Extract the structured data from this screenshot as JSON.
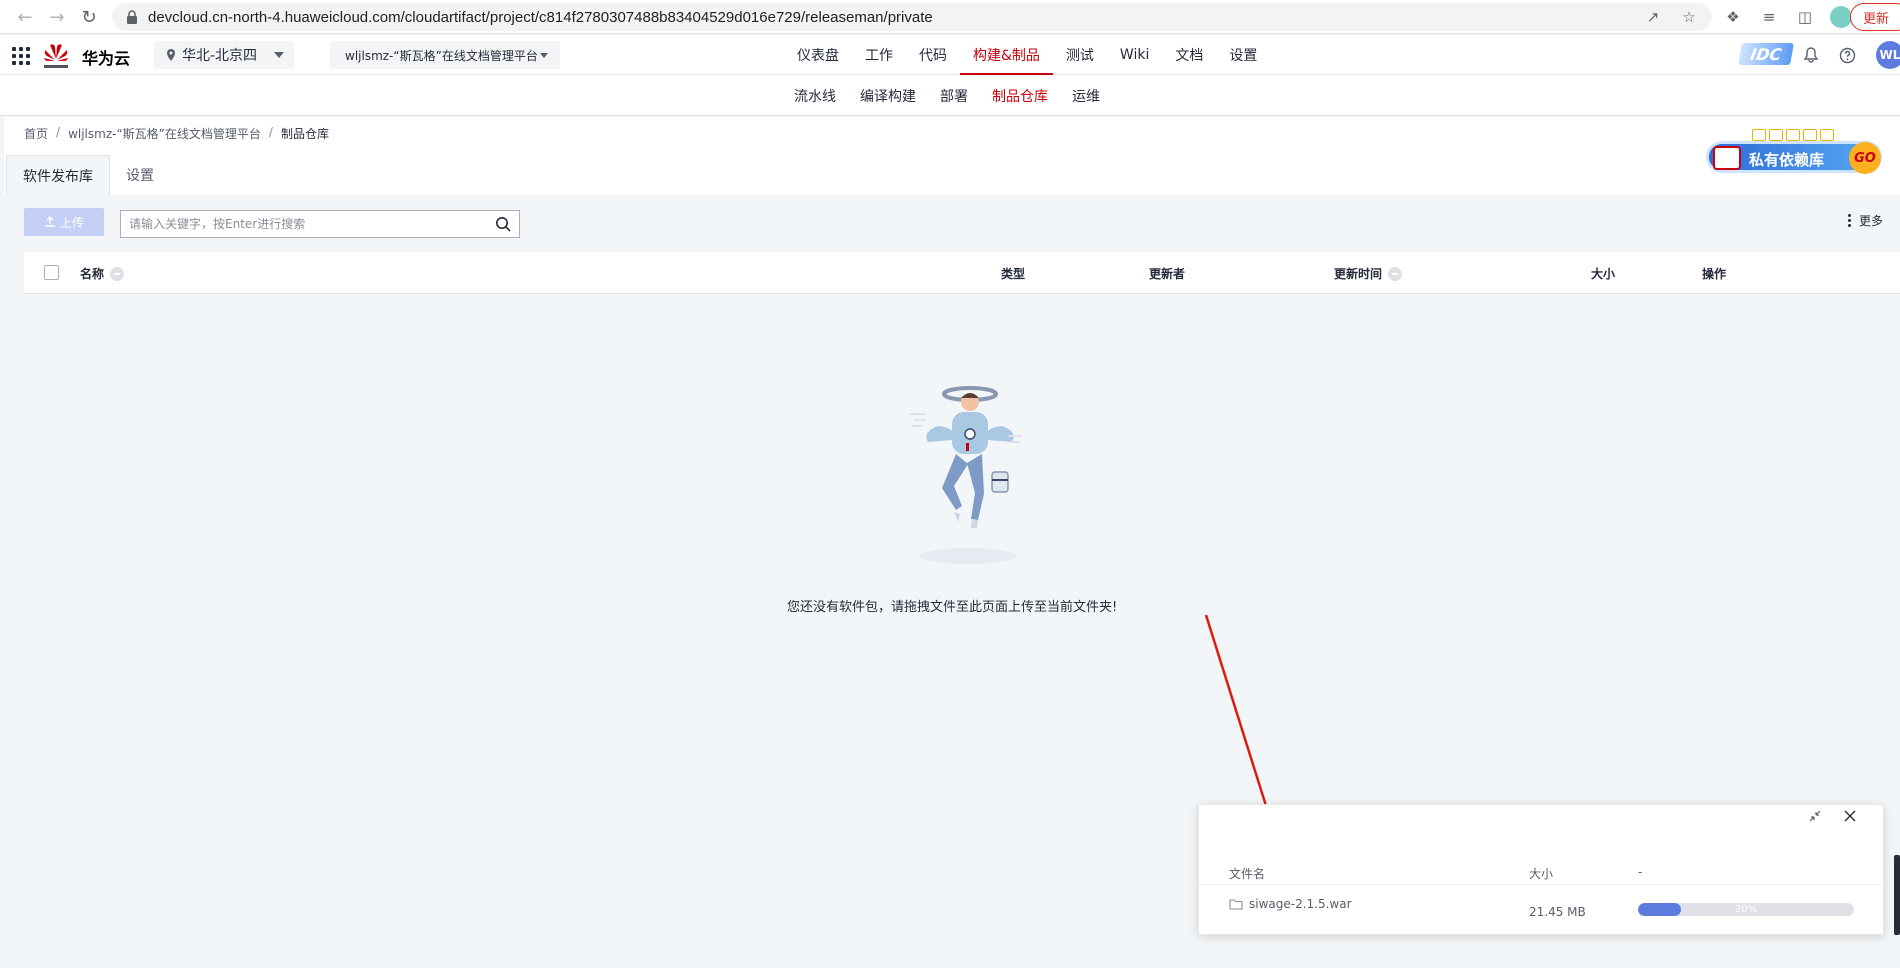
{
  "browser": {
    "url": "devcloud.cn-north-4.huaweicloud.com/cloudartifact/project/c814f2780307488b83404529d016e729/releaseman/private",
    "update_label": "更新"
  },
  "header": {
    "brand": "华为云",
    "region": "华北-北京四",
    "project": "wljlsmz-“斯瓦格”在线文档管理平台",
    "nav": [
      "仪表盘",
      "工作",
      "代码",
      "构建&制品",
      "测试",
      "Wiki",
      "文档",
      "设置"
    ],
    "active_nav": "构建&制品",
    "idc_badge": "IDC",
    "avatar": "WL"
  },
  "subnav": {
    "items": [
      "流水线",
      "编译构建",
      "部署",
      "制品仓库",
      "运维"
    ],
    "active": "制品仓库"
  },
  "breadcrumb": {
    "home": "首页",
    "project": "wljlsmz-“斯瓦格”在线文档管理平台",
    "current": "制品仓库"
  },
  "tabs": [
    "软件发布库",
    "设置"
  ],
  "promo": {
    "text": "私有依赖库",
    "go": "GO"
  },
  "toolbar": {
    "upload_label": "上传",
    "search_placeholder": "请输入关键字，按Enter进行搜索",
    "more_label": "更多"
  },
  "table": {
    "columns": [
      "名称",
      "类型",
      "更新者",
      "更新时间",
      "大小",
      "操作"
    ]
  },
  "empty": {
    "message": "您还没有软件包，请拖拽文件至此页面上传至当前文件夹!"
  },
  "upload_panel": {
    "col_filename": "文件名",
    "col_size": "大小",
    "col_extra": "-",
    "file": {
      "name": "siwage-2.1.5.war",
      "size": "21.45 MB",
      "progress_text": "20%",
      "progress": 0.2
    }
  },
  "colors": {
    "brand_red": "#c7000b",
    "primary_blue": "#5e7ce0",
    "annotation_arrow": "#e0190f"
  }
}
